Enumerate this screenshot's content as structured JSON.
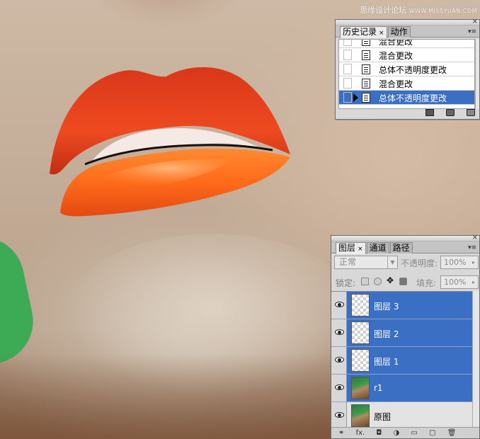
{
  "watermark": {
    "cn": "思缘设计论坛",
    "site": "WWW.MISSYUAN.COM"
  },
  "history_panel": {
    "tabs": [
      {
        "label": "历史记录",
        "close": "×"
      },
      {
        "label": "动作"
      }
    ],
    "items": [
      {
        "label": "混合更改",
        "selected": false
      },
      {
        "label": "混合更改",
        "selected": false
      },
      {
        "label": "总体不透明度更改",
        "selected": false
      },
      {
        "label": "混合更改",
        "selected": false
      },
      {
        "label": "总体不透明度更改",
        "selected": true
      }
    ],
    "footer_icons": [
      "new-document-icon",
      "snapshot-camera-icon",
      "trash-icon"
    ]
  },
  "layers_panel": {
    "tabs": [
      {
        "label": "图层",
        "close": "×"
      },
      {
        "label": "通道"
      },
      {
        "label": "路径"
      }
    ],
    "blend_mode": "正常",
    "opacity_label": "不透明度:",
    "opacity_value": "100%",
    "lock_label": "锁定:",
    "fill_label": "填充:",
    "fill_value": "100%",
    "layers": [
      {
        "name": "图层 3",
        "selected": true,
        "thumbnail": "transparent"
      },
      {
        "name": "图层 2",
        "selected": true,
        "thumbnail": "transparent"
      },
      {
        "name": "图层 1",
        "selected": true,
        "thumbnail": "transparent"
      },
      {
        "name": "r1",
        "selected": true,
        "thumbnail": "photo"
      },
      {
        "name": "原图",
        "selected": false,
        "thumbnail": "photo"
      }
    ],
    "footer_icons": [
      "link-layers-icon",
      "fx-icon",
      "layer-mask-icon",
      "adjustment-layer-icon",
      "group-folder-icon",
      "new-layer-icon",
      "trash-icon"
    ],
    "footer_labels": {
      "link": "⚭",
      "fx": "fx.",
      "mask": "◘",
      "adjust": "◑",
      "group": "▭",
      "new": "▢",
      "trash": "🗑"
    }
  },
  "colors": {
    "selection_blue": "#3a6fc4",
    "lipstick_upper": "#e8401e",
    "lipstick_lower": "#ff7a22",
    "skin": "#c9b39e"
  }
}
